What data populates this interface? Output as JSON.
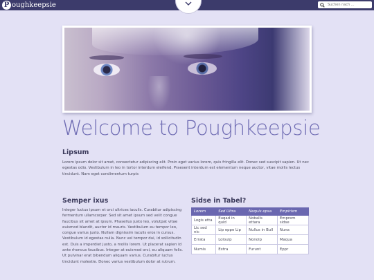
{
  "topbar": {
    "logo_letter": "P",
    "logo_text": "oughkeepsie",
    "menu_icon": "chevron-down-icon",
    "search_icon": "search-icon",
    "search_placeholder": "Suchen nach ..."
  },
  "hero": {
    "image_description": "close-up of a face, eyes"
  },
  "main": {
    "title": "Welcome to Poughkeepsie",
    "intro_heading": "Lipsum",
    "intro_text": "Lorem ipsum dolor sit amet, consectetur adipiscing elit. Proin eget varius lorem, quis fringilla elit. Donec sed suscipit sapien. Ut nec egestas odio. Vestibulum in leo in tortor interdum eleifend. Praesent interdum est elementum neque auctor, vitae mollis lectus tincidunt. Nam eget condimentum turpis",
    "left_heading": "Semper ixus",
    "left_text": "Integer luctus ipsum et orci ultrices iaculis. Curabitur adipiscing fermentum ullamcorper. Sed sit amet ipsum sed velit congue faucibus sit amet at ipsum. Phasellus justo leo, volutpat vitae euismod blandit, auctor id mauris. Vestibulum eu tempor leo, congue varius justo. Nullam dignissim iaculis eros in cursus. Vestibulum id egestas nulla. Nunc vel tempor dui, id sollicitudin est. Duis a imperdiet justo, a mollis lorem. Ut placerat sapien id ante rhoncus faucibus. Integer at euismod orci, eu aliquam felis. Ut pulvinar erat bibendum aliquam varius. Curabitur luctus tincidunt molestie. Donec varius vestibulum dolor at rutrum.",
    "right_heading": "Sidse in Tabel?",
    "table": {
      "headers": [
        "Lorem",
        "Sed Ultra",
        "Nequis epsa",
        "Empirism"
      ],
      "rows": [
        [
          "Logis etta",
          "Euqad in quid",
          "Noballs ettara",
          "Emprem sidse"
        ],
        [
          "Lic sed nic",
          "Lip eppe Lip",
          "Nullus in Bull",
          "Nuna"
        ],
        [
          "Errata",
          "Loloulp",
          "Nonolp",
          "Maqua"
        ],
        [
          "Numis",
          "Extra",
          "Furunt",
          "Eppr"
        ]
      ]
    }
  }
}
